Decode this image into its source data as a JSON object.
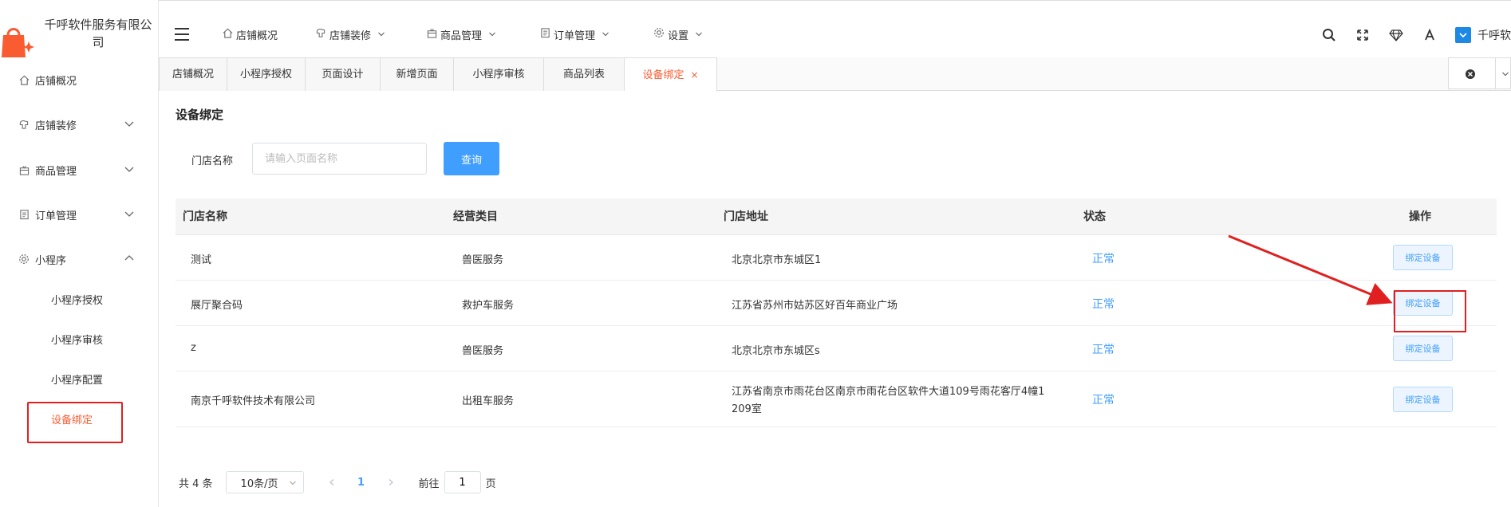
{
  "app": {
    "company_name": "千呼软件服务有限公司"
  },
  "sidebar": {
    "items": [
      {
        "label": "店铺概况",
        "icon": "home-icon"
      },
      {
        "label": "店铺装修",
        "icon": "paint-icon"
      },
      {
        "label": "商品管理",
        "icon": "gift-icon"
      },
      {
        "label": "订单管理",
        "icon": "clipboard-icon"
      },
      {
        "label": "小程序",
        "icon": "gear-icon"
      }
    ],
    "sub_items": [
      "小程序授权",
      "小程序审核",
      "小程序配置",
      "设备绑定"
    ]
  },
  "topnav": {
    "items": [
      {
        "label": "店铺概况"
      },
      {
        "label": "店铺装修"
      },
      {
        "label": "商品管理"
      },
      {
        "label": "订单管理"
      },
      {
        "label": "设置"
      }
    ],
    "user_name": "千呼软"
  },
  "tabs": [
    "店铺概况",
    "小程序授权",
    "页面设计",
    "新增页面",
    "小程序审核",
    "商品列表",
    "设备绑定"
  ],
  "page": {
    "title": "设备绑定",
    "filter_label": "门店名称",
    "filter_placeholder": "请输入页面名称",
    "query_button": "查询"
  },
  "table": {
    "headers": [
      "门店名称",
      "经营类目",
      "门店地址",
      "状态",
      "操作"
    ],
    "rows": [
      {
        "name": "测试",
        "category": "兽医服务",
        "address": "北京北京市东城区1",
        "status": "正常",
        "action": "绑定设备"
      },
      {
        "name": "展厅聚合码",
        "category": "救护车服务",
        "address": "江苏省苏州市姑苏区好百年商业广场",
        "status": "正常",
        "action": "绑定设备"
      },
      {
        "name": "z",
        "category": "兽医服务",
        "address": "北京北京市东城区s",
        "status": "正常",
        "action": "绑定设备"
      },
      {
        "name": "南京千呼软件技术有限公司",
        "category": "出租车服务",
        "address_line1": "江苏省南京市雨花台区南京市雨花台区软件大道109号雨花客厅4幢1",
        "address_line2": "209室",
        "status": "正常",
        "action": "绑定设备"
      }
    ]
  },
  "pagination": {
    "total": "共 4 条",
    "page_size": "10条/页",
    "current_page": "1",
    "goto_label": "前往",
    "goto_value": "1",
    "page_suffix": "页"
  },
  "colors": {
    "accent": "#fa5c32",
    "primary": "#409eff",
    "annotation": "#e02020"
  }
}
